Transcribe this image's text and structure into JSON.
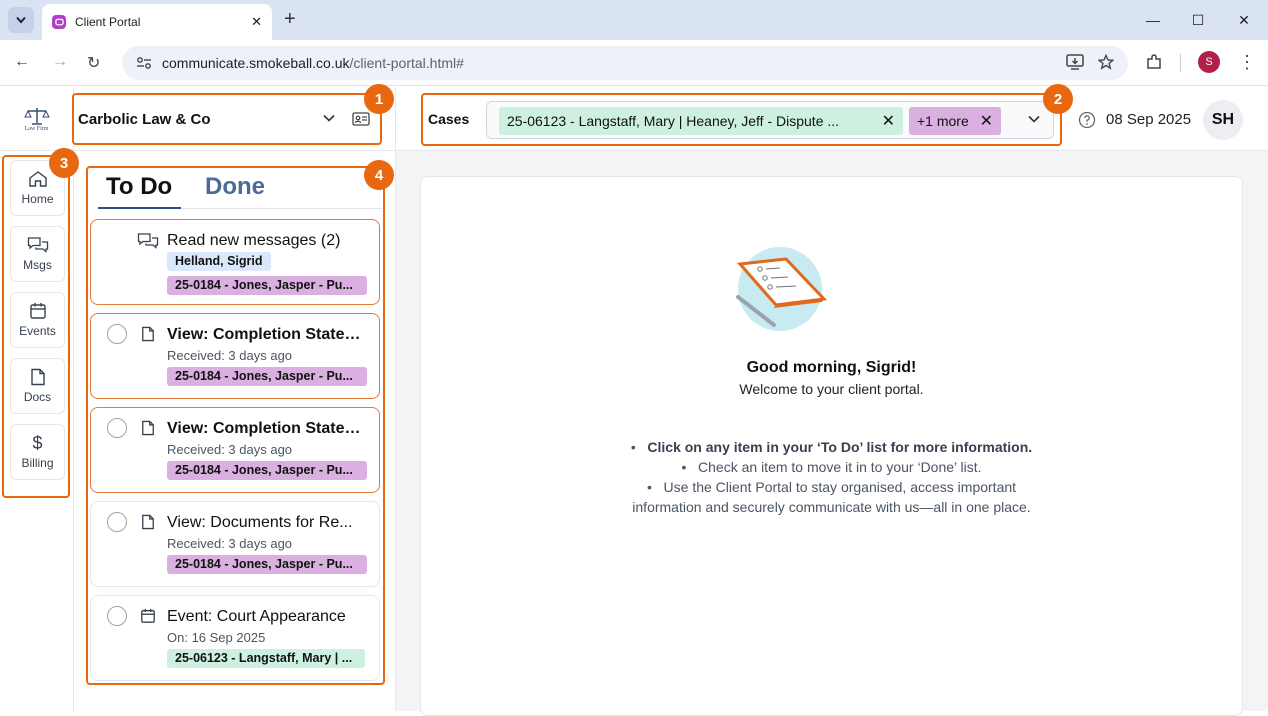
{
  "browser": {
    "tab_title": "Client Portal",
    "url_host": "communicate.smokeball.co.uk",
    "url_path": "/client-portal.html#",
    "profile_initial": "S"
  },
  "header": {
    "firm_name": "Carbolic Law & Co",
    "logo_text": "Law Firm",
    "cases_label": "Cases",
    "case_chip": "25-06123 - Langstaff, Mary | Heaney, Jeff - Dispute ...",
    "more_chip": "+1 more",
    "date": "08 Sep 2025",
    "avatar_initials": "SH"
  },
  "sidebar": {
    "items": [
      {
        "label": "Home",
        "icon": "home-icon"
      },
      {
        "label": "Msgs",
        "icon": "chat-icon"
      },
      {
        "label": "Events",
        "icon": "calendar-icon"
      },
      {
        "label": "Docs",
        "icon": "document-icon"
      },
      {
        "label": "Billing",
        "icon": "dollar-icon"
      }
    ]
  },
  "todo": {
    "tab_todo": "To Do",
    "tab_done": "Done",
    "items": [
      {
        "title": "Read new messages (2)",
        "sub": "",
        "tag1": "Helland, Sigrid",
        "tag2": "25-0184 - Jones, Jasper - Pu..."
      },
      {
        "title": "View: Completion Statem...",
        "sub": "Received: 3 days ago",
        "tag": "25-0184 - Jones, Jasper - Pu..."
      },
      {
        "title": "View: Completion Statem...",
        "sub": "Received: 3 days ago",
        "tag": "25-0184 - Jones, Jasper - Pu..."
      },
      {
        "title": "View: Documents for Re...",
        "sub": "Received: 3 days ago",
        "tag": "25-0184 - Jones, Jasper - Pu..."
      },
      {
        "title": "Event: Court Appearance",
        "sub": "On: 16 Sep 2025",
        "tag": "25-06123 - Langstaff, Mary | ..."
      }
    ]
  },
  "main": {
    "greeting": "Good morning, Sigrid!",
    "welcome": "Welcome to your client portal.",
    "tips": [
      "Click on any item in your ‘To Do’ list for more information.",
      "Check an item to move it in to your ‘Done’ list.",
      "Use the Client Portal to stay organised, access important",
      "information and securely communicate with us—all in one place."
    ]
  },
  "annotations": [
    "1",
    "2",
    "3",
    "4"
  ],
  "colors": {
    "accent": "#e8680f",
    "green_chip": "#cdf0e1",
    "purple_chip": "#d9b0e0"
  }
}
